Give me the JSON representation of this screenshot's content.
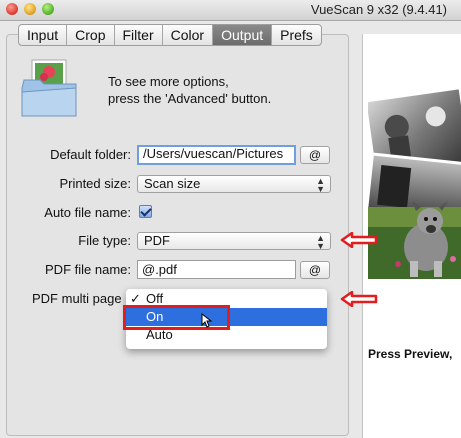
{
  "window": {
    "title": "VueScan 9 x32 (9.4.41)"
  },
  "tabs": [
    {
      "label": "Input",
      "active": false
    },
    {
      "label": "Crop",
      "active": false
    },
    {
      "label": "Filter",
      "active": false
    },
    {
      "label": "Color",
      "active": false
    },
    {
      "label": "Output",
      "active": true
    },
    {
      "label": "Prefs",
      "active": false
    }
  ],
  "info": {
    "line1": "To see more options,",
    "line2": "press the 'Advanced' button."
  },
  "form": {
    "default_folder": {
      "label": "Default folder:",
      "value": "/Users/vuescan/Pictures",
      "button": "@"
    },
    "printed_size": {
      "label": "Printed size:",
      "value": "Scan size"
    },
    "auto_file_name": {
      "label": "Auto file name:",
      "checked": true
    },
    "file_type": {
      "label": "File type:",
      "value": "PDF"
    },
    "pdf_file_name": {
      "label": "PDF file name:",
      "value": "@.pdf",
      "button": "@"
    },
    "pdf_multi_page": {
      "label": "PDF multi page"
    }
  },
  "menu": {
    "items": [
      {
        "label": "Off",
        "checked": true,
        "check_mark": "✓"
      },
      {
        "label": "On",
        "selected": true
      },
      {
        "label": "Auto"
      }
    ]
  },
  "preview": {
    "caption": "Press Preview,"
  },
  "colors": {
    "accent": "#2e6fe0",
    "highlight_red": "#e31d1d",
    "active_tab": "#777777"
  },
  "icons": [
    "folder-photo-icon",
    "up-down-arrows-icon",
    "checkbox-checked-icon",
    "mouse-cursor-icon",
    "red-arrow-icon"
  ]
}
